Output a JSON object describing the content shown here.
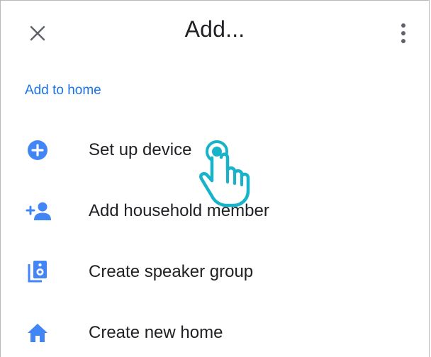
{
  "app_bar": {
    "title": "Add...",
    "close_icon": "close-icon",
    "more_icon": "more-vert-icon"
  },
  "section": {
    "header": "Add to home"
  },
  "menu": {
    "items": [
      {
        "label": "Set up device",
        "icon": "add-circle-icon"
      },
      {
        "label": "Add household member",
        "icon": "add-person-icon"
      },
      {
        "label": "Create speaker group",
        "icon": "speaker-group-icon"
      },
      {
        "label": "Create new home",
        "icon": "home-icon"
      }
    ]
  },
  "colors": {
    "accent": "#1a73e8",
    "icon_blue": "#4285f4",
    "text": "#202124",
    "pointer": "#17b3c9"
  }
}
